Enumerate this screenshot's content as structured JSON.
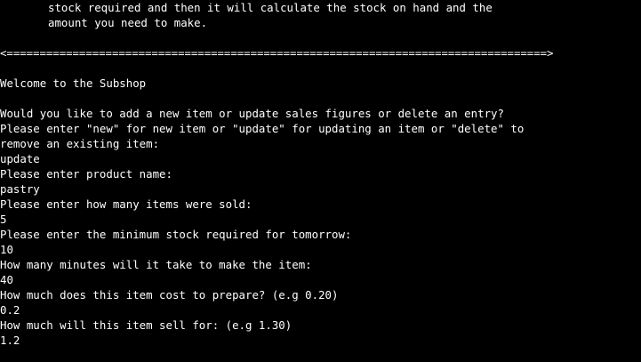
{
  "terminal": {
    "intro_line_1": "stock required and then it will calculate the stock on hand and the",
    "intro_line_2": "amount you need to make.",
    "divider": "<==================================================================================>",
    "welcome": "Welcome to the Subshop",
    "question": "Would you like to add a new item or update sales figures or delete an entry?",
    "instruction_line_1": "Please enter \"new\" for new item or \"update\" for updating an item or \"delete\" to",
    "instruction_line_2": "remove an existing item:",
    "action_input": "update",
    "product_prompt": "Please enter product name:",
    "product_input": "pastry",
    "sold_prompt": "Please enter how many items were sold:",
    "sold_input": "5",
    "min_stock_prompt": "Please enter the minimum stock required for tomorrow:",
    "min_stock_input": "10",
    "minutes_prompt": "How many minutes will it take to make the item:",
    "minutes_input": "40",
    "cost_prompt": "How much does this item cost to prepare? (e.g 0.20)",
    "cost_input": "0.2",
    "sell_prompt": "How much will this item sell for: (e.g 1.30)",
    "sell_input": "1.2"
  }
}
